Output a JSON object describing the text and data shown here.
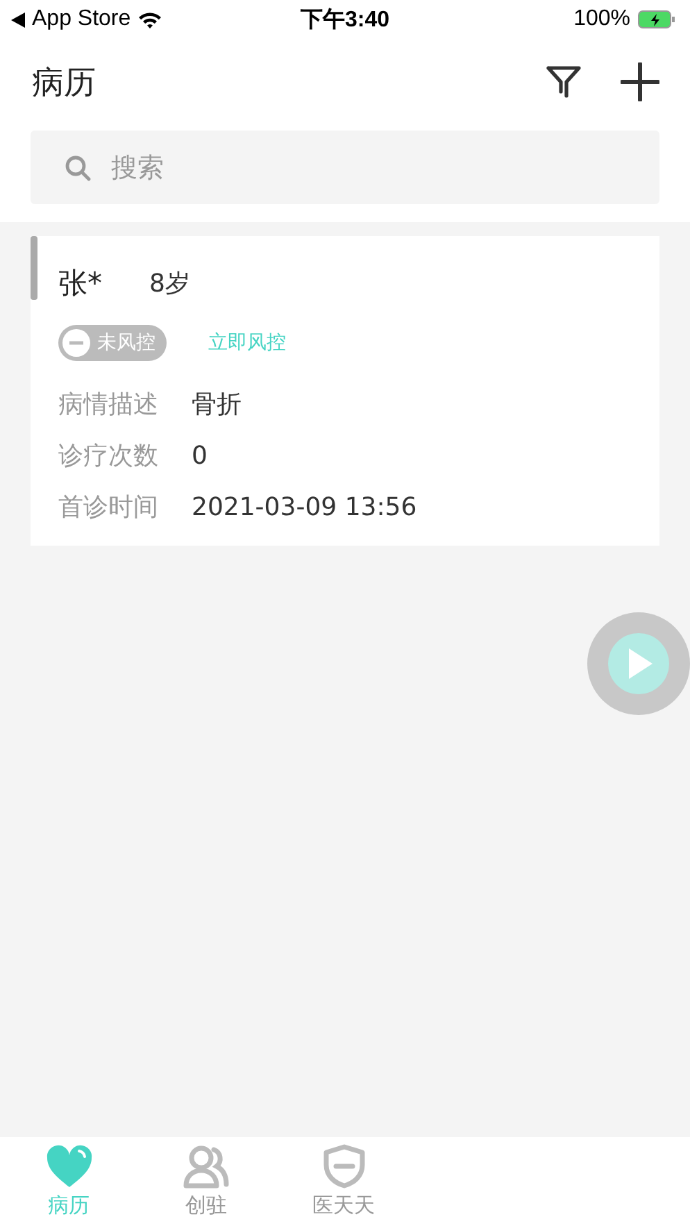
{
  "status_bar": {
    "back_label": "App Store",
    "time": "下午3:40",
    "battery": "100%"
  },
  "header": {
    "title": "病历"
  },
  "search": {
    "placeholder": "搜索"
  },
  "records": [
    {
      "name": "张*",
      "age": "8岁",
      "risk_controlled": false,
      "risk_label": "未风控",
      "action": "立即风控",
      "fields": [
        {
          "label": "病情描述",
          "value": "骨折"
        },
        {
          "label": "诊疗次数",
          "value": "0"
        },
        {
          "label": "首诊时间",
          "value": "2021-03-09 13:56"
        }
      ]
    }
  ],
  "tab_bar": [
    {
      "label": "病历",
      "kind": "heart",
      "selected": true
    },
    {
      "label": "创驻",
      "kind": "people",
      "selected": false
    },
    {
      "label": "医天天",
      "kind": "shield",
      "selected": false
    }
  ]
}
